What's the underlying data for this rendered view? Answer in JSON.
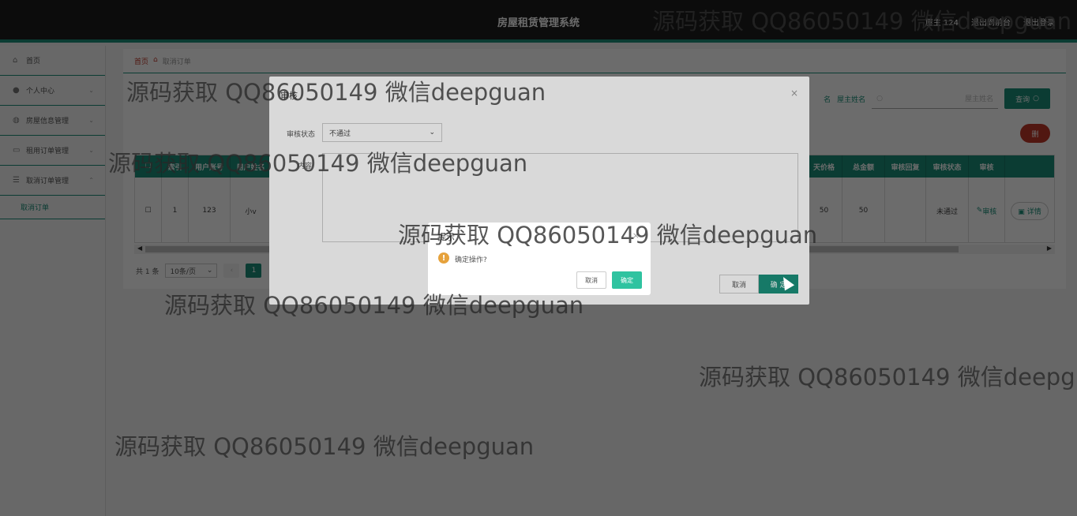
{
  "header": {
    "title": "房屋租赁管理系统",
    "user": "屋主 124",
    "back_label": "退出到前台",
    "logout_label": "退出登录"
  },
  "sidebar": {
    "items": [
      {
        "label": "首页",
        "icon": "home-icon"
      },
      {
        "label": "个人中心",
        "icon": "user-icon"
      },
      {
        "label": "房屋信息管理",
        "icon": "globe-icon"
      },
      {
        "label": "租用订单管理",
        "icon": "chat-icon"
      },
      {
        "label": "取消订单管理",
        "icon": "list-icon"
      }
    ],
    "sub": "取消订单"
  },
  "breadcrumb": {
    "home": "首页",
    "current": "取消订单"
  },
  "search": {
    "partial_label": "名",
    "label": "屋主姓名",
    "placeholder": "屋主姓名",
    "button": "查询"
  },
  "delete_label": "删",
  "table": {
    "head_left": [
      "",
      "索引",
      "用户账号",
      "用户姓名"
    ],
    "head_right": [
      "天价格",
      "总金额",
      "审核回复",
      "审核状态",
      "审核",
      ""
    ],
    "row_left": [
      "",
      "1",
      "123",
      "小v"
    ],
    "row_right": [
      "50",
      "50",
      "",
      "未通过",
      "审核",
      "详情"
    ]
  },
  "pager": {
    "total": "共 1 条",
    "size": "10条/页",
    "current": "1"
  },
  "audit_dialog": {
    "title": "审核",
    "status_label": "审核状态",
    "status_value": "不通过",
    "reply_label": "内容",
    "cancel": "取消",
    "ok": "确 定"
  },
  "confirm_dialog": {
    "title": "提示",
    "message": "确定操作?",
    "cancel": "取消",
    "ok": "确定"
  },
  "watermark": "源码获取 QQ86050149 微信deepguan",
  "colors": {
    "primary": "#1a8f7a",
    "danger": "#c0392b",
    "warn": "#e6a23c"
  }
}
